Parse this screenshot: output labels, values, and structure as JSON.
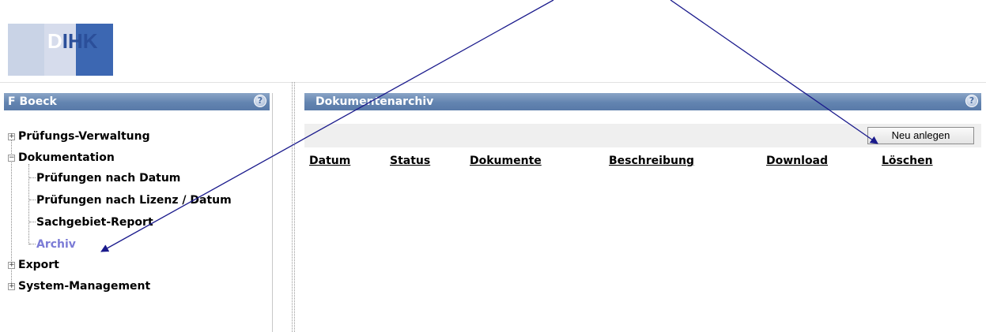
{
  "logo": {
    "text_white": "D",
    "text_blue": "IHK"
  },
  "sidebar": {
    "user": "F Boeck",
    "items": [
      {
        "label": "Prüfungs-Verwaltung",
        "expander": "+"
      },
      {
        "label": "Dokumentation",
        "expander": "−"
      },
      {
        "label": "Prüfungen nach Datum"
      },
      {
        "label": "Prüfungen nach Lizenz / Datum"
      },
      {
        "label": "Sachgebiet-Report"
      },
      {
        "label": "Archiv",
        "selected": true,
        "color": "#7b7bd6"
      },
      {
        "label": "Export",
        "expander": "+"
      },
      {
        "label": "System-Management",
        "expander": "+"
      }
    ]
  },
  "main": {
    "title": "Dokumentenarchiv",
    "new_button": "Neu anlegen",
    "columns": [
      "Datum",
      "Status",
      "Dokumente",
      "Beschreibung",
      "Download",
      "Löschen"
    ]
  },
  "help_glyph": "?",
  "colors": {
    "header": "#6384b0",
    "arrow": "#1a1a8c",
    "selected": "#7b7bd6"
  }
}
